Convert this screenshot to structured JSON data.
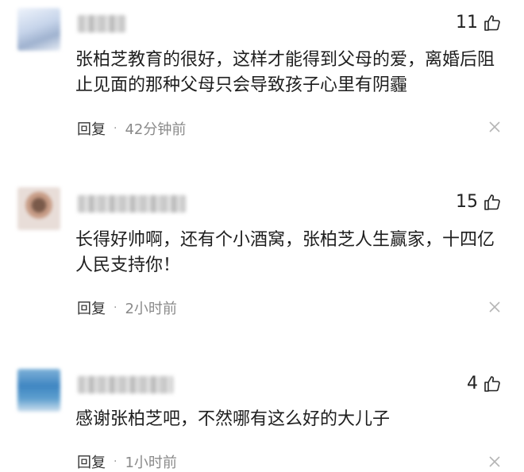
{
  "comments": [
    {
      "likes": "11",
      "text": "张柏芝教育的很好，这样才能得到父母的爱，离婚后阻止见面的那种父母只会导致孩子心里有阴霾",
      "reply_label": "回复",
      "separator": "·",
      "time": "42分钟前"
    },
    {
      "likes": "15",
      "text": "长得好帅啊，还有个小酒窝，张柏芝人生赢家，十四亿人民支持你！",
      "reply_label": "回复",
      "separator": "·",
      "time": "2小时前"
    },
    {
      "likes": "4",
      "text": "感谢张柏芝吧，不然哪有这么好的大儿子",
      "reply_label": "回复",
      "separator": "·",
      "time": "1小时前"
    }
  ],
  "icons": {
    "like": "thumbs-up-icon",
    "close": "close-icon",
    "avatar": "avatar"
  },
  "colors": {
    "text": "#1e1e1e",
    "meta": "#8a8a8a",
    "background": "#ffffff"
  }
}
